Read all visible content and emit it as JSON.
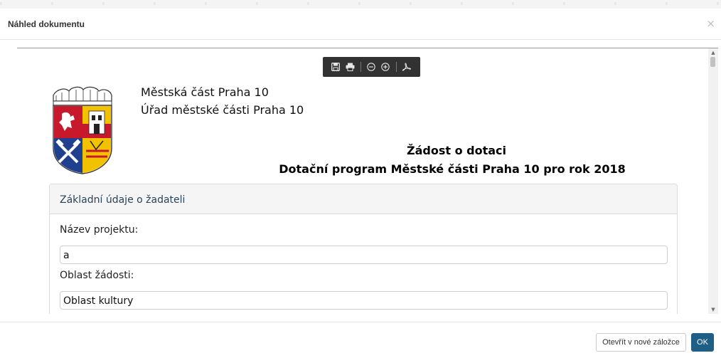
{
  "modal": {
    "title": "Náhled dokumentu",
    "close_glyph": "×"
  },
  "toolbar": {
    "icons": [
      "save-icon",
      "print-icon",
      "zoom-out-icon",
      "zoom-in-icon",
      "acrobat-icon"
    ]
  },
  "document": {
    "org_line1": "Městská část Praha 10",
    "org_line2": "Úřad městské části Praha 10",
    "title": "Žádost o dotaci",
    "subtitle": "Dotační program Městské části Praha 10 pro rok 2018",
    "section": {
      "heading": "Základní údaje o žadateli",
      "fields": [
        {
          "label": "Název projektu:",
          "value": "a"
        },
        {
          "label": "Oblast žádosti:",
          "value": "Oblast kultury"
        }
      ]
    }
  },
  "footer": {
    "open_new_tab_label": "Otevřít v nové záložce",
    "ok_label": "OK"
  },
  "colors": {
    "primary": "#1f5e85",
    "toolbar_bg": "#323232",
    "panel_heading": "#2b4357"
  }
}
